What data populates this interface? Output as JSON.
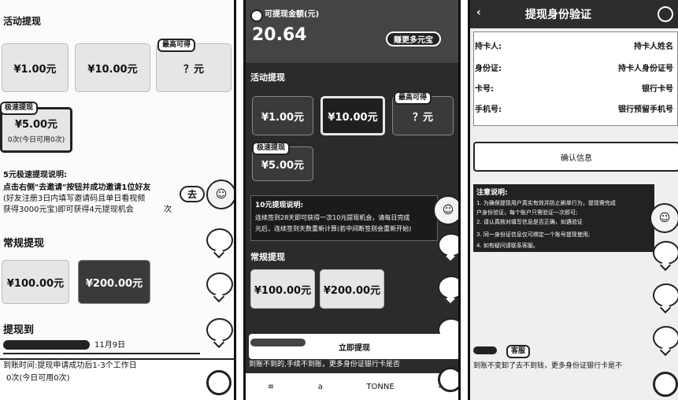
{
  "panel1": {
    "activity_title": "活动提现",
    "cards": [
      "¥1.00元",
      "¥10.00元",
      "？元"
    ],
    "tag_more": "最高可得",
    "quick_tag": "极速提现",
    "quick_amount": "¥5.00元",
    "quick_count": "0次(今日可用0次)",
    "notes_title": "5元极速提现说明:",
    "notes_lines": [
      "点击右侧\"去邀请\"按钮并成功邀请1位好友",
      "(好友注册3日内填写邀请码且单日看视频",
      "获得3000元宝)即可获得4元提现机会",
      "次"
    ],
    "go_btn": "去",
    "regular_title": "常规提现",
    "regular_cards": [
      "¥100.00元",
      "¥200.00元"
    ],
    "record_title": "提现到",
    "record_date": "11月9日",
    "footer_lines": [
      "到账时间:提现申请成功后1-3个工作日",
      "0次(今日可用0次)"
    ]
  },
  "panel2": {
    "balance_label": "可提现金额(元)",
    "balance_value": "20.64",
    "earn_btn": "赚更多元宝",
    "activity_title": "活动提现",
    "cards": [
      "¥1.00元",
      "¥10.00元",
      "？元"
    ],
    "tag_more": "最高可得",
    "quick_tag": "极速提现",
    "quick_amount": "¥5.00元",
    "notes_title": "10元提现说明:",
    "notes_lines": [
      "连续签到28天即可获得一次10元提现机会，请每日完成",
      "元后，连续签到天数重新计算(若中间断签则会重新开始)"
    ],
    "regular_title": "常规提现",
    "regular_cards": [
      "¥100.00元",
      "¥200.00元"
    ],
    "withdraw_btn": "立即提现",
    "footer_line": "到账不到的,手续不到账，更多身份证银行卡是否",
    "nav": [
      "≡",
      "a",
      "TONNE",
      "‹"
    ]
  },
  "panel3": {
    "title": "提现身份验证",
    "fields": [
      {
        "label": "持卡人:",
        "value": "持卡人姓名"
      },
      {
        "label": "身份证:",
        "value": "持卡人身份证号"
      },
      {
        "label": "卡号:",
        "value": "银行卡号"
      },
      {
        "label": "手机号:",
        "value": "银行预留手机号"
      }
    ],
    "confirm_btn": "确认信息",
    "notes_title": "注意说明:",
    "notes_lines": [
      "1. 为确保提现用户真实有效并防止刷单行为，提现需完成",
      "户身份验证，每个账户只需验证一次即可;",
      "2. 请认真核对填写信息是否正确，如遇验证",
      "3. 同一身份证信息仅可绑定一个账号提现使用;",
      "4. 如有疑问请联系客服。"
    ],
    "footer_tag": "客服",
    "footer_line": "到账不变卸了去不到钱，更多身份证银行卡是不"
  }
}
